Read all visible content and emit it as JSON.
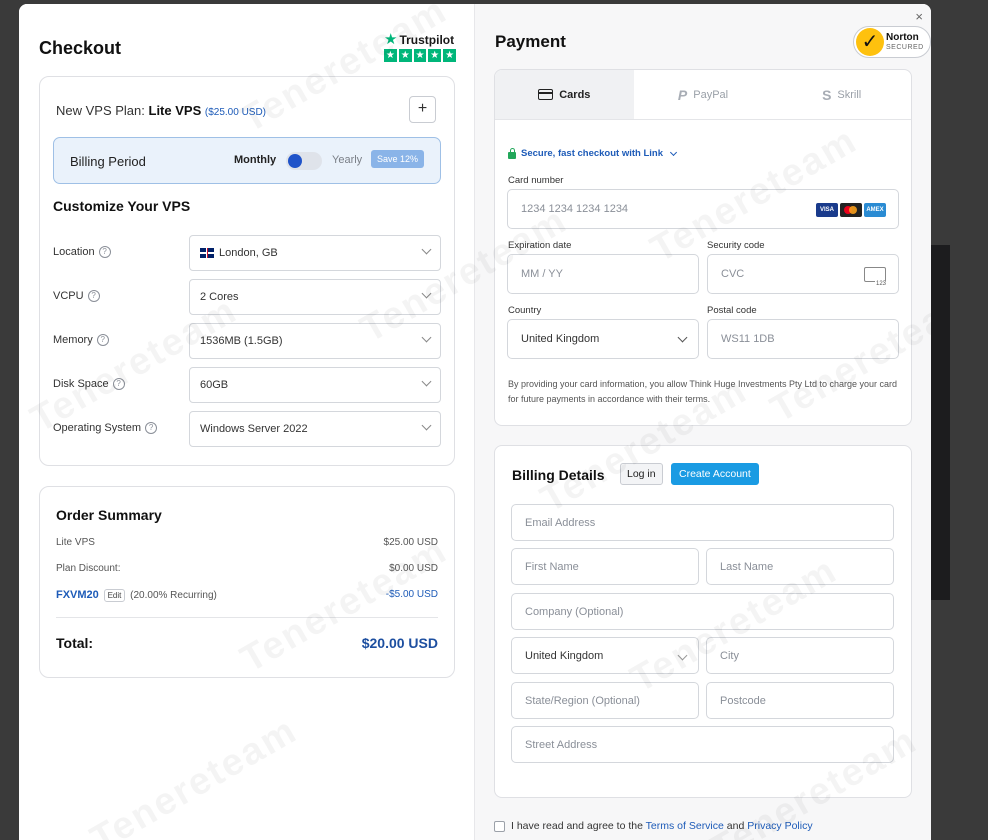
{
  "watermark": "Tenereteam",
  "checkout": {
    "title": "Checkout",
    "trustpilot": {
      "label": "Trustpilot",
      "star": "★",
      "stars": 5
    },
    "plan": {
      "prefix": "New VPS Plan:",
      "name": "Lite VPS",
      "price": "($25.00 USD)",
      "add_label": "+"
    },
    "billing": {
      "label": "Billing Period",
      "monthly": "Monthly",
      "yearly": "Yearly",
      "save_badge": "Save 12%"
    },
    "customize_title": "Customize Your VPS",
    "fields": [
      {
        "label": "Location",
        "value": "London, GB",
        "flag": "uk-flag-icon"
      },
      {
        "label": "VCPU",
        "value": "2 Cores"
      },
      {
        "label": "Memory",
        "value": "1536MB (1.5GB)"
      },
      {
        "label": "Disk Space",
        "value": "60GB"
      },
      {
        "label": "Operating System",
        "value": "Windows Server 2022"
      }
    ],
    "help_glyph": "?"
  },
  "order": {
    "title": "Order Summary",
    "lines": [
      {
        "label": "Lite VPS",
        "value": "$25.00 USD"
      },
      {
        "label": "Plan Discount:",
        "value": "$0.00 USD"
      }
    ],
    "coupon": {
      "code": "FXVM20",
      "edit": "Edit",
      "desc": "(20.00% Recurring)",
      "value": "-$5.00 USD"
    },
    "total_label": "Total:",
    "total_value": "$20.00 USD"
  },
  "payment": {
    "title": "Payment",
    "norton": {
      "check": "✓",
      "name": "Norton",
      "sub": "SECURED"
    },
    "tabs": [
      {
        "label": "Cards",
        "icon": "card-icon"
      },
      {
        "label": "PayPal",
        "icon": "paypal-icon",
        "glyph": "P"
      },
      {
        "label": "Skrill",
        "icon": "skrill-icon",
        "glyph": "S"
      }
    ],
    "link_text": "Secure, fast checkout with Link",
    "card_number": {
      "label": "Card number",
      "placeholder": "1234 1234 1234 1234"
    },
    "card_brands": [
      "VISA",
      "",
      "AMEX"
    ],
    "expiry": {
      "label": "Expiration date",
      "placeholder": "MM / YY"
    },
    "cvc": {
      "label": "Security code",
      "placeholder": "CVC"
    },
    "country": {
      "label": "Country",
      "value": "United Kingdom"
    },
    "postal": {
      "label": "Postal code",
      "placeholder": "WS11 1DB"
    },
    "terms": "By providing your card information, you allow Think Huge Investments Pty Ltd to charge your card for future payments in accordance with their terms."
  },
  "billing_details": {
    "title": "Billing Details",
    "login": "Log in",
    "create": "Create Account",
    "email": "Email Address",
    "first": "First Name",
    "last": "Last Name",
    "company": "Company (Optional)",
    "country": "United Kingdom",
    "city": "City",
    "state": "State/Region (Optional)",
    "postcode": "Postcode",
    "street": "Street Address"
  },
  "agree": {
    "prefix": "I have read and agree to the",
    "tos": "Terms of Service",
    "and": "and",
    "privacy": "Privacy Policy"
  },
  "close_glyph": "×"
}
